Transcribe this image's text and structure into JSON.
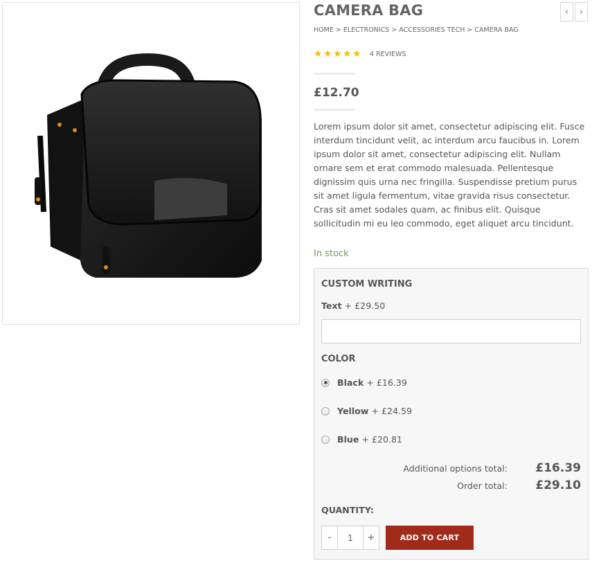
{
  "product": {
    "title": "CAMERA BAG",
    "image_alt": "camera-bag-image",
    "breadcrumb": [
      "HOME",
      "ELECTRONICS",
      "ACCESSORIES TECH",
      "CAMERA BAG"
    ],
    "breadcrumb_separator": " > ",
    "rating": 5,
    "rating_max": 5,
    "reviews_label": "4 REVIEWS",
    "price": "£12.70",
    "description": "Lorem ipsum dolor sit amet, consectetur adipiscing elit. Fusce interdum tincidunt velit, ac interdum arcu faucibus in. Lorem ipsum dolor sit amet, consectetur adipiscing elit. Nullam ornare sem et erat commodo malesuada. Pellentesque dignissim quis urna nec fringilla. Suspendisse pretium purus sit amet ligula fermentum, vitae gravida risus consectetur. Cras sit amet sodales quam, ac finibus elit. Quisque sollicitudin mi eu leo commodo, eget aliquet arcu tincidunt.",
    "stock": "In stock"
  },
  "pager": {
    "prev_icon": "chevron-left-icon",
    "next_icon": "chevron-right-icon",
    "prev_glyph": "‹",
    "next_glyph": "›"
  },
  "options": {
    "custom_writing": {
      "heading": "CUSTOM WRITING",
      "field_name": "Text",
      "field_price": " + £29.50",
      "value": "",
      "placeholder": ""
    },
    "color": {
      "heading": "COLOR",
      "choices": [
        {
          "name": "Black",
          "price": " + £16.39",
          "checked": true
        },
        {
          "name": "Yellow",
          "price": " + £24.59",
          "checked": false
        },
        {
          "name": "Blue",
          "price": " + £20.81",
          "checked": false
        }
      ]
    },
    "totals": {
      "additional_label": "Additional options total:",
      "additional_value": "£16.39",
      "order_label": "Order total:",
      "order_value": "£29.10"
    }
  },
  "cart": {
    "quantity_label": "QUANTITY:",
    "minus": "-",
    "plus": "+",
    "quantity": "1",
    "add_label": "ADD TO CART"
  },
  "colors": {
    "in_stock": "#6a9a5b",
    "add_to_cart": "#a02b1b",
    "star": "#f5bd00"
  }
}
